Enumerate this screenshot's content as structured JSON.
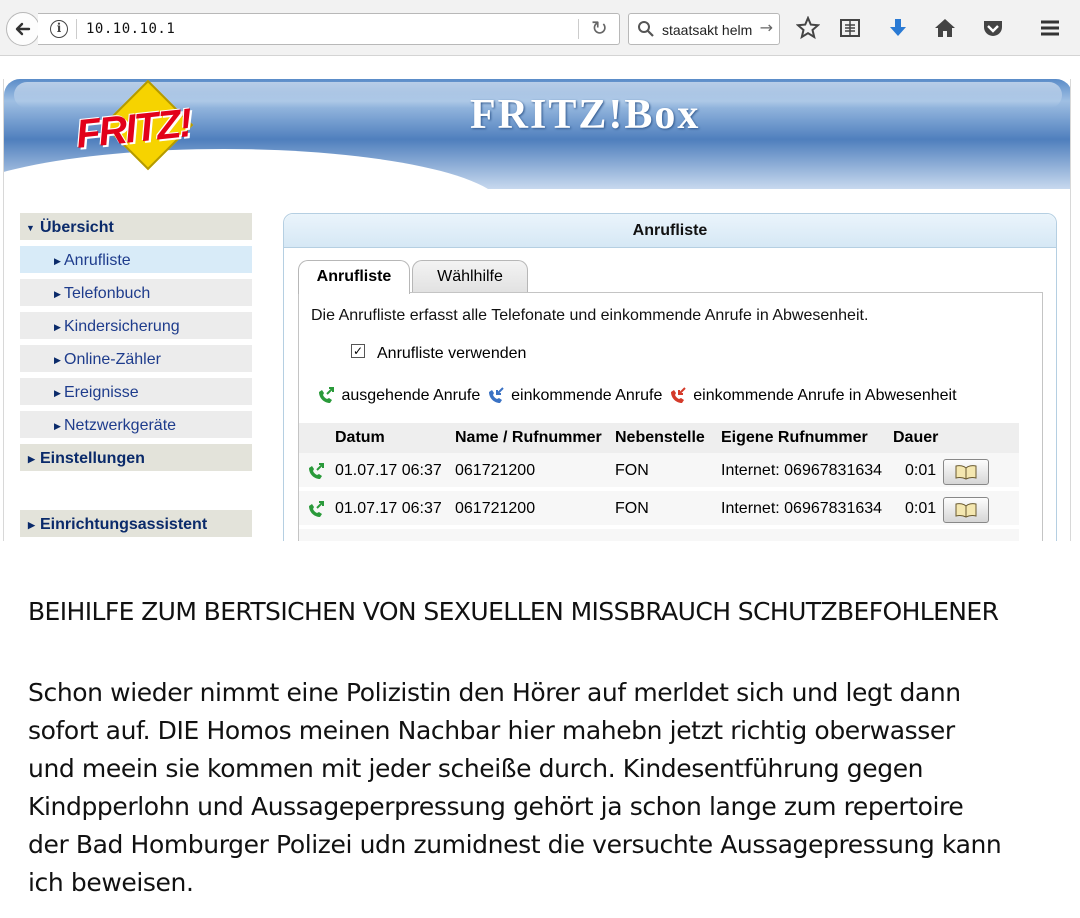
{
  "browser": {
    "url": "10.10.10.1",
    "search_text": "staatsakt helm",
    "icons": [
      "back-arrow-icon",
      "info-icon",
      "reload-icon",
      "search-icon",
      "star-icon",
      "reader-icon",
      "download-icon",
      "home-icon",
      "pocket-icon",
      "menu-icon"
    ]
  },
  "fritz": {
    "logo_text": "FRITZ!",
    "brand_title": "FRITZ!Box",
    "colors": {
      "banner": "#4f7fbd",
      "logo_red": "#e2001a",
      "logo_yellow": "#f6d300",
      "nav_text": "#1e3c8c"
    }
  },
  "sidebar": {
    "items": [
      {
        "label": "Übersicht",
        "level": "head",
        "expanded": true
      },
      {
        "label": "Anrufliste",
        "level": "sub",
        "active": true
      },
      {
        "label": "Telefonbuch",
        "level": "sub"
      },
      {
        "label": "Kindersicherung",
        "level": "sub"
      },
      {
        "label": "Online-Zähler",
        "level": "sub"
      },
      {
        "label": "Ereignisse",
        "level": "sub"
      },
      {
        "label": "Netzwerkgeräte",
        "level": "sub"
      },
      {
        "label": "Einstellungen",
        "level": "head",
        "expanded": false
      },
      {
        "label": "Einrichtungsassistent",
        "level": "head",
        "expanded": false
      }
    ]
  },
  "panel": {
    "title": "Anrufliste",
    "tabs": [
      {
        "label": "Anrufliste",
        "active": true
      },
      {
        "label": "Wählhilfe",
        "active": false
      }
    ],
    "description": "Die Anrufliste erfasst alle Telefonate und einkommende Anrufe in Abwesenheit.",
    "checkbox_label": "Anrufliste verwenden",
    "checkbox_checked": true,
    "legend": {
      "outgoing": "ausgehende Anrufe",
      "incoming": "einkommende Anrufe",
      "missed": "einkommende Anrufe in Abwesenheit"
    },
    "table": {
      "headers": [
        "Datum",
        "Name / Rufnummer",
        "Nebenstelle",
        "Eigene Rufnummer",
        "Dauer"
      ],
      "rows": [
        {
          "type": "outgoing",
          "datum": "01.07.17 06:37",
          "name": "061721200",
          "nebenstelle": "FON",
          "eigene": "Internet: 06967831634",
          "dauer": "0:01"
        },
        {
          "type": "outgoing",
          "datum": "01.07.17 06:37",
          "name": "061721200",
          "nebenstelle": "FON",
          "eigene": "Internet: 06967831634",
          "dauer": "0:01"
        }
      ]
    }
  },
  "caption": {
    "heading": "BEIHILFE ZUM BERTSICHEN VON SEXUELLEN MISSBRAUCH SCHUTZBEFOHLENER",
    "lines": [
      "Schon wieder nimmt eine Polizistin den Hörer auf merldet sich und legt dann",
      "sofort auf. DIE Homos meinen Nachbar hier mahebn jetzt richtig oberwasser",
      "und meein sie kommen mit jeder scheiße durch. Kindesentführung gegen",
      "Kindpperlohn und Aussageperpressung gehört ja schon lange zum repertoire",
      "der Bad Homburger Polizei udn zumidnest die versuchte Aussagepressung kann",
      "ich beweisen."
    ]
  }
}
